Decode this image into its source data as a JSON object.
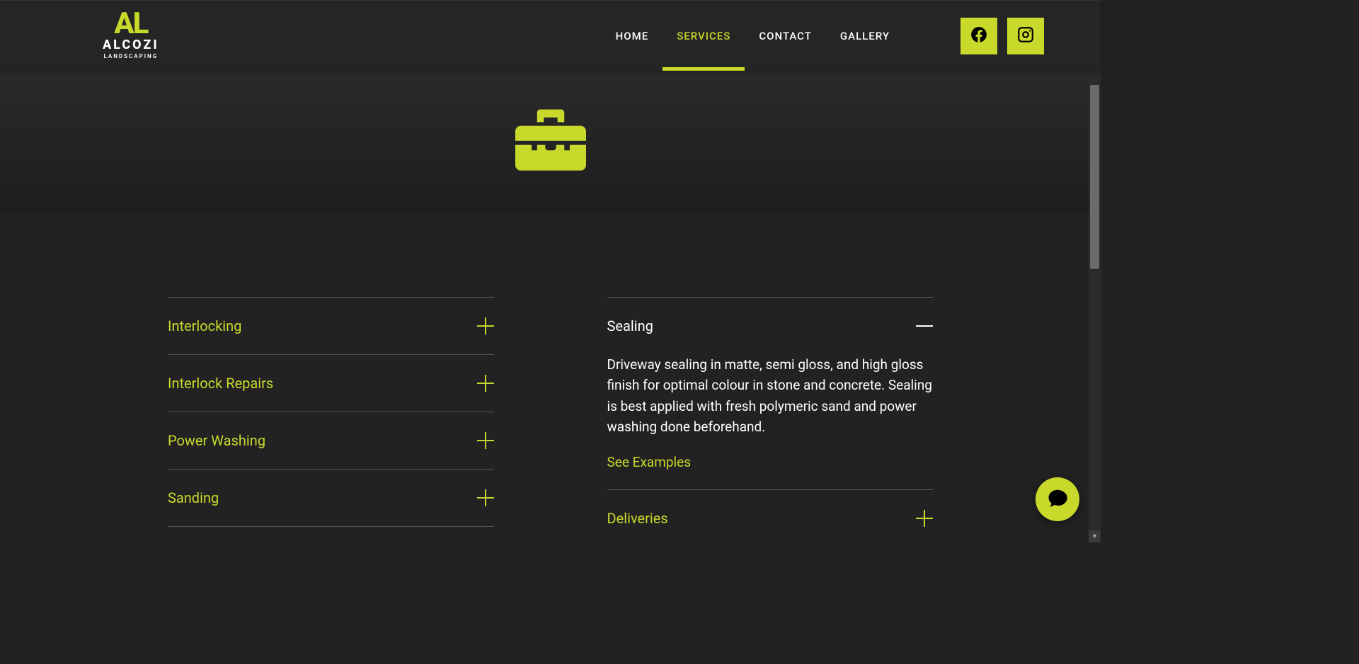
{
  "brand": {
    "top": "AL",
    "mid": "ALCOZI",
    "sub": "LANDSCAPING"
  },
  "nav": {
    "home": "HOME",
    "services": "SERVICES",
    "contact": "CONTACT",
    "gallery": "GALLERY"
  },
  "accordion_left": [
    {
      "title": "Interlocking"
    },
    {
      "title": "Interlock Repairs"
    },
    {
      "title": "Power Washing"
    },
    {
      "title": "Sanding"
    }
  ],
  "accordion_right": {
    "sealing": {
      "title": "Sealing",
      "body": "Driveway sealing in matte, semi gloss, and high gloss finish for optimal colour in stone and concrete. Sealing is best applied with fresh polymeric sand and power washing done beforehand.",
      "link": "See Examples"
    },
    "deliveries": {
      "title": "Deliveries"
    }
  },
  "colors": {
    "accent": "#c9d92b",
    "bg": "#222222"
  }
}
